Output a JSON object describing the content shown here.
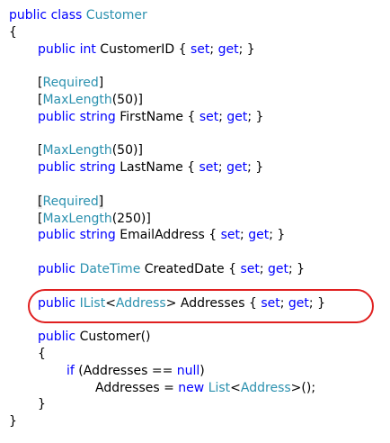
{
  "colors": {
    "keyword": "#0000ff",
    "type": "#2b91af",
    "plain": "#000000",
    "highlight_oval": "#e02020",
    "background": "#ffffff"
  },
  "editor": {
    "lines": [
      {
        "indent": 0,
        "tokens": [
          {
            "t": "public",
            "c": "kw"
          },
          {
            "t": " ",
            "c": "pl"
          },
          {
            "t": "class",
            "c": "kw"
          },
          {
            "t": " ",
            "c": "pl"
          },
          {
            "t": "Customer",
            "c": "tp"
          }
        ]
      },
      {
        "indent": 0,
        "tokens": [
          {
            "t": "{",
            "c": "pl"
          }
        ]
      },
      {
        "indent": 1,
        "tokens": [
          {
            "t": "public",
            "c": "kw"
          },
          {
            "t": " ",
            "c": "pl"
          },
          {
            "t": "int",
            "c": "kw"
          },
          {
            "t": " CustomerID { ",
            "c": "pl"
          },
          {
            "t": "set",
            "c": "kw"
          },
          {
            "t": "; ",
            "c": "pl"
          },
          {
            "t": "get",
            "c": "kw"
          },
          {
            "t": "; }",
            "c": "pl"
          }
        ]
      },
      {
        "indent": 0,
        "tokens": []
      },
      {
        "indent": 1,
        "tokens": [
          {
            "t": "[",
            "c": "pl"
          },
          {
            "t": "Required",
            "c": "tp"
          },
          {
            "t": "]",
            "c": "pl"
          }
        ]
      },
      {
        "indent": 1,
        "tokens": [
          {
            "t": "[",
            "c": "pl"
          },
          {
            "t": "MaxLength",
            "c": "tp"
          },
          {
            "t": "(50)]",
            "c": "pl"
          }
        ]
      },
      {
        "indent": 1,
        "tokens": [
          {
            "t": "public",
            "c": "kw"
          },
          {
            "t": " ",
            "c": "pl"
          },
          {
            "t": "string",
            "c": "kw"
          },
          {
            "t": " FirstName { ",
            "c": "pl"
          },
          {
            "t": "set",
            "c": "kw"
          },
          {
            "t": "; ",
            "c": "pl"
          },
          {
            "t": "get",
            "c": "kw"
          },
          {
            "t": "; }",
            "c": "pl"
          }
        ]
      },
      {
        "indent": 0,
        "tokens": []
      },
      {
        "indent": 1,
        "tokens": [
          {
            "t": "[",
            "c": "pl"
          },
          {
            "t": "MaxLength",
            "c": "tp"
          },
          {
            "t": "(50)]",
            "c": "pl"
          }
        ]
      },
      {
        "indent": 1,
        "tokens": [
          {
            "t": "public",
            "c": "kw"
          },
          {
            "t": " ",
            "c": "pl"
          },
          {
            "t": "string",
            "c": "kw"
          },
          {
            "t": " LastName { ",
            "c": "pl"
          },
          {
            "t": "set",
            "c": "kw"
          },
          {
            "t": "; ",
            "c": "pl"
          },
          {
            "t": "get",
            "c": "kw"
          },
          {
            "t": "; }",
            "c": "pl"
          }
        ]
      },
      {
        "indent": 0,
        "tokens": []
      },
      {
        "indent": 1,
        "tokens": [
          {
            "t": "[",
            "c": "pl bm"
          },
          {
            "t": "Required",
            "c": "tp"
          },
          {
            "t": "]",
            "c": "pl bm"
          }
        ]
      },
      {
        "indent": 1,
        "tokens": [
          {
            "t": "[",
            "c": "pl"
          },
          {
            "t": "MaxLength",
            "c": "tp"
          },
          {
            "t": "(250)]",
            "c": "pl"
          }
        ]
      },
      {
        "indent": 1,
        "tokens": [
          {
            "t": "public",
            "c": "kw"
          },
          {
            "t": " ",
            "c": "pl"
          },
          {
            "t": "string",
            "c": "kw"
          },
          {
            "t": " EmailAddress { ",
            "c": "pl"
          },
          {
            "t": "set",
            "c": "kw"
          },
          {
            "t": "; ",
            "c": "pl"
          },
          {
            "t": "get",
            "c": "kw"
          },
          {
            "t": "; }",
            "c": "pl"
          }
        ]
      },
      {
        "indent": 0,
        "tokens": []
      },
      {
        "indent": 1,
        "tokens": [
          {
            "t": "public",
            "c": "kw"
          },
          {
            "t": " ",
            "c": "pl"
          },
          {
            "t": "DateTime",
            "c": "tp"
          },
          {
            "t": " CreatedDate { ",
            "c": "pl"
          },
          {
            "t": "set",
            "c": "kw"
          },
          {
            "t": "; ",
            "c": "pl"
          },
          {
            "t": "get",
            "c": "kw"
          },
          {
            "t": "; }",
            "c": "pl"
          }
        ]
      },
      {
        "indent": 0,
        "tokens": []
      },
      {
        "indent": 1,
        "tokens": [
          {
            "t": "public",
            "c": "kw"
          },
          {
            "t": " ",
            "c": "pl"
          },
          {
            "t": "IList",
            "c": "tp"
          },
          {
            "t": "<",
            "c": "pl"
          },
          {
            "t": "Address",
            "c": "tp"
          },
          {
            "t": "> Addresses { ",
            "c": "pl"
          },
          {
            "t": "set",
            "c": "kw"
          },
          {
            "t": "; ",
            "c": "pl"
          },
          {
            "t": "get",
            "c": "kw"
          },
          {
            "t": "; }",
            "c": "pl"
          }
        ]
      },
      {
        "indent": 0,
        "tokens": []
      },
      {
        "indent": 1,
        "tokens": [
          {
            "t": "public",
            "c": "kw"
          },
          {
            "t": " Customer()",
            "c": "pl"
          }
        ]
      },
      {
        "indent": 1,
        "tokens": [
          {
            "t": "{",
            "c": "pl"
          }
        ]
      },
      {
        "indent": 2,
        "tokens": [
          {
            "t": "if",
            "c": "kw"
          },
          {
            "t": " (Addresses == ",
            "c": "pl"
          },
          {
            "t": "null",
            "c": "kw"
          },
          {
            "t": ")",
            "c": "pl"
          }
        ]
      },
      {
        "indent": 3,
        "tokens": [
          {
            "t": "Addresses = ",
            "c": "pl"
          },
          {
            "t": "new",
            "c": "kw"
          },
          {
            "t": " ",
            "c": "pl"
          },
          {
            "t": "List",
            "c": "tp"
          },
          {
            "t": "<",
            "c": "pl"
          },
          {
            "t": "Address",
            "c": "tp"
          },
          {
            "t": ">();",
            "c": "pl"
          }
        ]
      },
      {
        "indent": 1,
        "tokens": [
          {
            "t": "}",
            "c": "pl"
          }
        ]
      },
      {
        "indent": 0,
        "tokens": [
          {
            "t": "}",
            "c": "pl"
          }
        ]
      }
    ]
  }
}
